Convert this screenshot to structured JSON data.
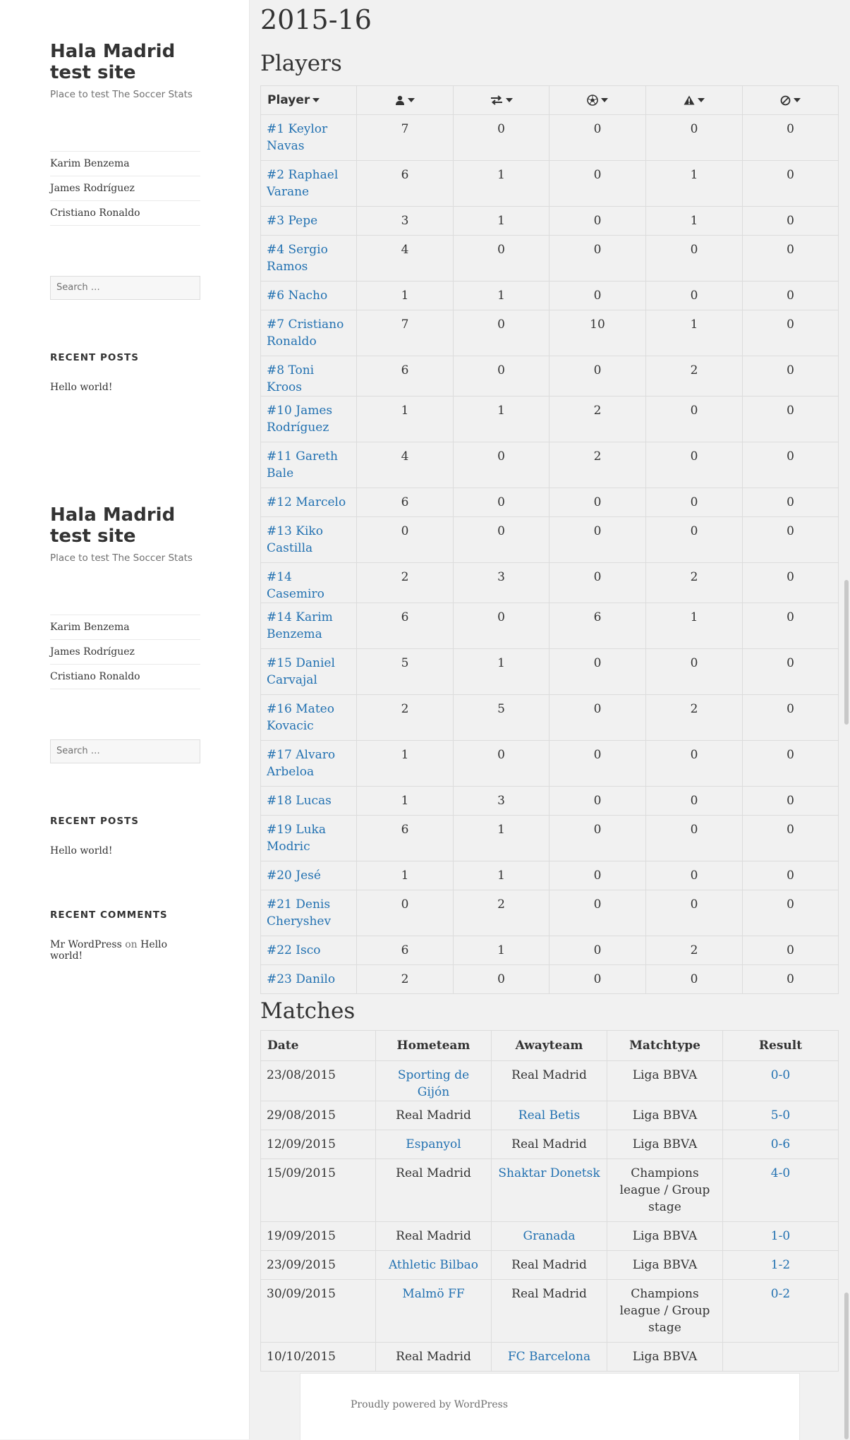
{
  "sidebar": {
    "blocks": [
      {
        "title": "Hala Madrid test site",
        "description": "Place to test The Soccer Stats",
        "menu": [
          "Karim Benzema",
          "James Rodríguez",
          "Cristiano Ronaldo"
        ],
        "search_placeholder": "Search …",
        "recent_posts_title": "RECENT POSTS",
        "recent_post": "Hello world!"
      },
      {
        "title": "Hala Madrid test site",
        "description": "Place to test The Soccer Stats",
        "menu": [
          "Karim Benzema",
          "James Rodríguez",
          "Cristiano Ronaldo"
        ],
        "search_placeholder": "Search …",
        "recent_posts_title": "RECENT POSTS",
        "recent_post": "Hello world!",
        "recent_comments_title": "RECENT COMMENTS",
        "comment_author": "Mr WordPress",
        "comment_on": "on",
        "comment_post": "Hello world!"
      }
    ]
  },
  "main": {
    "season": "2015-16",
    "players_heading": "Players",
    "players_columns": {
      "player": "Player",
      "icons": [
        "user-icon",
        "substitution-icon",
        "ball-icon",
        "warning-icon",
        "ban-icon"
      ]
    },
    "players": [
      {
        "name": "#1 Keylor Navas",
        "lines": [
          "#1 Keylor",
          "Navas"
        ],
        "stats": [
          7,
          0,
          0,
          0,
          0
        ]
      },
      {
        "name": "#2 Raphael Varane",
        "lines": [
          "#2 Raphael",
          "Varane"
        ],
        "stats": [
          6,
          1,
          0,
          1,
          0
        ]
      },
      {
        "name": "#3 Pepe",
        "lines": [
          "#3 Pepe"
        ],
        "stats": [
          3,
          1,
          0,
          1,
          0
        ]
      },
      {
        "name": "#4 Sergio Ramos",
        "lines": [
          "#4 Sergio",
          "Ramos"
        ],
        "stats": [
          4,
          0,
          0,
          0,
          0
        ]
      },
      {
        "name": "#6 Nacho",
        "lines": [
          "#6 Nacho"
        ],
        "stats": [
          1,
          1,
          0,
          0,
          0
        ]
      },
      {
        "name": "#7 Cristiano Ronaldo",
        "lines": [
          "#7 Cristiano",
          "Ronaldo"
        ],
        "stats": [
          7,
          0,
          10,
          1,
          0
        ]
      },
      {
        "name": "#8 Toni Kroos",
        "lines": [
          "#8 Toni Kroos"
        ],
        "stats": [
          6,
          0,
          0,
          2,
          0
        ]
      },
      {
        "name": "#10 James Rodríguez",
        "lines": [
          "#10 James",
          "Rodríguez"
        ],
        "stats": [
          1,
          1,
          2,
          0,
          0
        ]
      },
      {
        "name": "#11 Gareth Bale",
        "lines": [
          "#11 Gareth",
          "Bale"
        ],
        "stats": [
          4,
          0,
          2,
          0,
          0
        ]
      },
      {
        "name": "#12 Marcelo",
        "lines": [
          "#12 Marcelo"
        ],
        "stats": [
          6,
          0,
          0,
          0,
          0
        ]
      },
      {
        "name": "#13 Kiko Castilla",
        "lines": [
          "#13 Kiko",
          "Castilla"
        ],
        "stats": [
          0,
          0,
          0,
          0,
          0
        ]
      },
      {
        "name": "#14 Casemiro",
        "lines": [
          "#14 Casemiro"
        ],
        "stats": [
          2,
          3,
          0,
          2,
          0
        ]
      },
      {
        "name": "#14 Karim Benzema",
        "lines": [
          "#14 Karim",
          "Benzema"
        ],
        "stats": [
          6,
          0,
          6,
          1,
          0
        ]
      },
      {
        "name": "#15 Daniel Carvajal",
        "lines": [
          "#15 Daniel",
          "Carvajal"
        ],
        "stats": [
          5,
          1,
          0,
          0,
          0
        ]
      },
      {
        "name": "#16 Mateo Kovacic",
        "lines": [
          "#16 Mateo",
          "Kovacic"
        ],
        "stats": [
          2,
          5,
          0,
          2,
          0
        ]
      },
      {
        "name": "#17 Alvaro Arbeloa",
        "lines": [
          "#17 Alvaro",
          "Arbeloa"
        ],
        "stats": [
          1,
          0,
          0,
          0,
          0
        ]
      },
      {
        "name": "#18 Lucas",
        "lines": [
          "#18 Lucas"
        ],
        "stats": [
          1,
          3,
          0,
          0,
          0
        ]
      },
      {
        "name": "#19 Luka Modric",
        "lines": [
          "#19 Luka",
          "Modric"
        ],
        "stats": [
          6,
          1,
          0,
          0,
          0
        ]
      },
      {
        "name": "#20 Jesé",
        "lines": [
          "#20 Jesé"
        ],
        "stats": [
          1,
          1,
          0,
          0,
          0
        ]
      },
      {
        "name": "#21 Denis Cheryshev",
        "lines": [
          "#21 Denis",
          "Cheryshev"
        ],
        "stats": [
          0,
          2,
          0,
          0,
          0
        ]
      },
      {
        "name": "#22 Isco",
        "lines": [
          "#22 Isco"
        ],
        "stats": [
          6,
          1,
          0,
          2,
          0
        ]
      },
      {
        "name": "#23 Danilo",
        "lines": [
          "#23 Danilo"
        ],
        "stats": [
          2,
          0,
          0,
          0,
          0
        ]
      }
    ],
    "matches_heading": "Matches",
    "matches_columns": [
      "Date",
      "Hometeam",
      "Awayteam",
      "Matchtype",
      "Result"
    ],
    "matches": [
      {
        "date": "23/08/2015",
        "home": "Sporting de Gijón",
        "home_link": true,
        "away": "Real Madrid",
        "away_link": false,
        "type": [
          "Liga BBVA"
        ],
        "result": "0-0"
      },
      {
        "date": "29/08/2015",
        "home": "Real Madrid",
        "home_link": false,
        "away": "Real Betis",
        "away_link": true,
        "type": [
          "Liga BBVA"
        ],
        "result": "5-0"
      },
      {
        "date": "12/09/2015",
        "home": "Espanyol",
        "home_link": true,
        "away": "Real Madrid",
        "away_link": false,
        "type": [
          "Liga BBVA"
        ],
        "result": "0-6"
      },
      {
        "date": "15/09/2015",
        "home": "Real Madrid",
        "home_link": false,
        "away": "Shaktar Donetsk",
        "away_link": true,
        "type": [
          "Champions",
          "league / Group",
          "stage"
        ],
        "result": "4-0"
      },
      {
        "date": "19/09/2015",
        "home": "Real Madrid",
        "home_link": false,
        "away": "Granada",
        "away_link": true,
        "type": [
          "Liga BBVA"
        ],
        "result": "1-0"
      },
      {
        "date": "23/09/2015",
        "home": "Athletic Bilbao",
        "home_link": true,
        "away": "Real Madrid",
        "away_link": false,
        "type": [
          "Liga BBVA"
        ],
        "result": "1-2"
      },
      {
        "date": "30/09/2015",
        "home": "Malmö FF",
        "home_link": true,
        "away": "Real Madrid",
        "away_link": false,
        "type": [
          "Champions",
          "league / Group",
          "stage"
        ],
        "result": "0-2"
      },
      {
        "date": "10/10/2015",
        "home": "Real Madrid",
        "home_link": false,
        "away": "FC Barcelona",
        "away_link": true,
        "type": [
          "Liga BBVA"
        ],
        "result": ""
      }
    ]
  },
  "footer": {
    "text": "Proudly powered by WordPress"
  },
  "colors": {
    "link": "#2271b1",
    "text": "#333333",
    "muted": "#707070",
    "background": "#f1f1f1"
  }
}
